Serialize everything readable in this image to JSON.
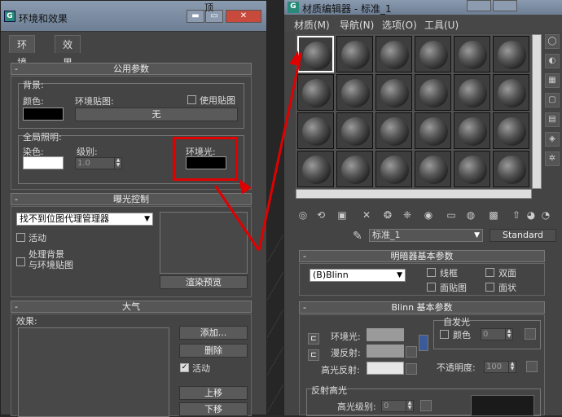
{
  "left_window": {
    "title": "环境和效果",
    "title_prefix": "顶",
    "tabs": [
      "环境",
      "效果"
    ],
    "common_params": {
      "header": "公用参数",
      "background_group": "背景:",
      "color_label": "颜色:",
      "env_map_label": "环境贴图:",
      "use_map_label": "使用贴图",
      "none_button": "无",
      "global_illum_group": "全局照明:",
      "tint_label": "染色:",
      "level_label": "级别:",
      "level_value": "1.0",
      "ambient_label": "环境光:"
    },
    "exposure": {
      "header": "曝光控制",
      "dropdown_value": "找不到位图代理管理器",
      "active_label": "活动",
      "process_bg_label_1": "处理背景",
      "process_bg_label_2": "与环境贴图",
      "render_preview_button": "渲染预览"
    },
    "atmosphere": {
      "header": "大气",
      "effects_label": "效果:",
      "add_button": "添加...",
      "delete_button": "删除",
      "active_label": "活动",
      "move_up_button": "上移",
      "move_down_button": "下移"
    }
  },
  "right_window": {
    "title": "材质编辑器 - 标准_1",
    "menu": [
      "材质(M)",
      "导航(N)",
      "选项(O)",
      "工具(U)"
    ],
    "material_name": "标准_1",
    "material_type": "Standard",
    "shader_params": {
      "header": "明暗器基本参数",
      "shader_value": "(B)Blinn",
      "wire_label": "线框",
      "two_sided_label": "双面",
      "face_map_label": "面贴图",
      "faceted_label": "面状"
    },
    "blinn_params": {
      "header": "Blinn 基本参数",
      "ambient_label": "环境光:",
      "diffuse_label": "漫反射:",
      "specular_label": "高光反射:",
      "self_illum_group": "自发光",
      "color_label": "颜色",
      "self_illum_value": "0",
      "opacity_label": "不透明度:",
      "opacity_value": "100",
      "spec_highlights_group": "反射高光",
      "spec_level_label": "高光级别:",
      "spec_level_value": "0"
    }
  },
  "colors": {
    "highlight_red": "#e00000",
    "ambient_swatch": "#000000",
    "background_swatch": "#000000",
    "tint_swatch": "#ffffff"
  }
}
